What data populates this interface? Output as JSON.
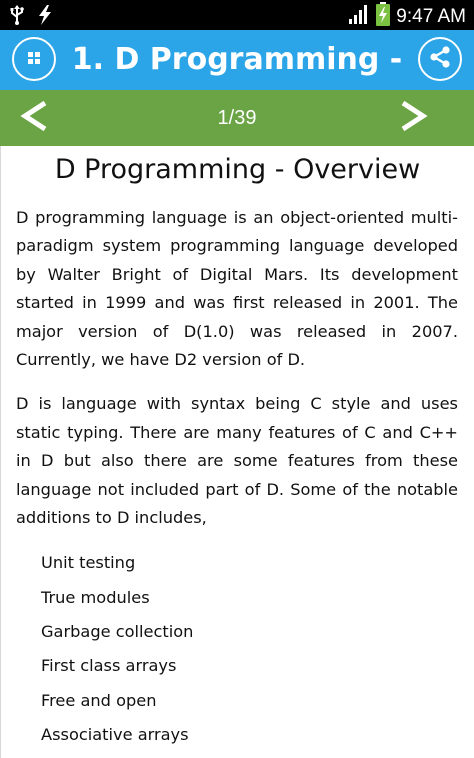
{
  "status_bar": {
    "time": "9:47 AM",
    "icons": [
      "usb-icon",
      "lightning-icon",
      "signal-icon",
      "battery-charging-icon"
    ]
  },
  "action_bar": {
    "title": "1. D Programming -",
    "menu_icon": "grid-menu-icon",
    "share_icon": "share-icon",
    "color": "#2ba5e7"
  },
  "nav_bar": {
    "prev_label": "<",
    "next_label": ">",
    "page_indicator": "1/39",
    "color": "#6aa445"
  },
  "article": {
    "title": "D Programming - Overview",
    "paragraphs": [
      "D programming language is an object-oriented multi-paradigm system programming language developed by Walter Bright of Digital Mars. Its development started in 1999 and was first released in 2001. The major version of D(1.0) was released in 2007. Currently, we have D2 version of D.",
      "D is language with syntax being C style and uses static typing. There are many features of C and C++ in D but also there are some features from these language not included part of D. Some of the notable additions to D includes,"
    ],
    "features": [
      "Unit testing",
      "True modules",
      "Garbage collection",
      "First class arrays",
      "Free and open",
      "Associative arrays"
    ]
  }
}
